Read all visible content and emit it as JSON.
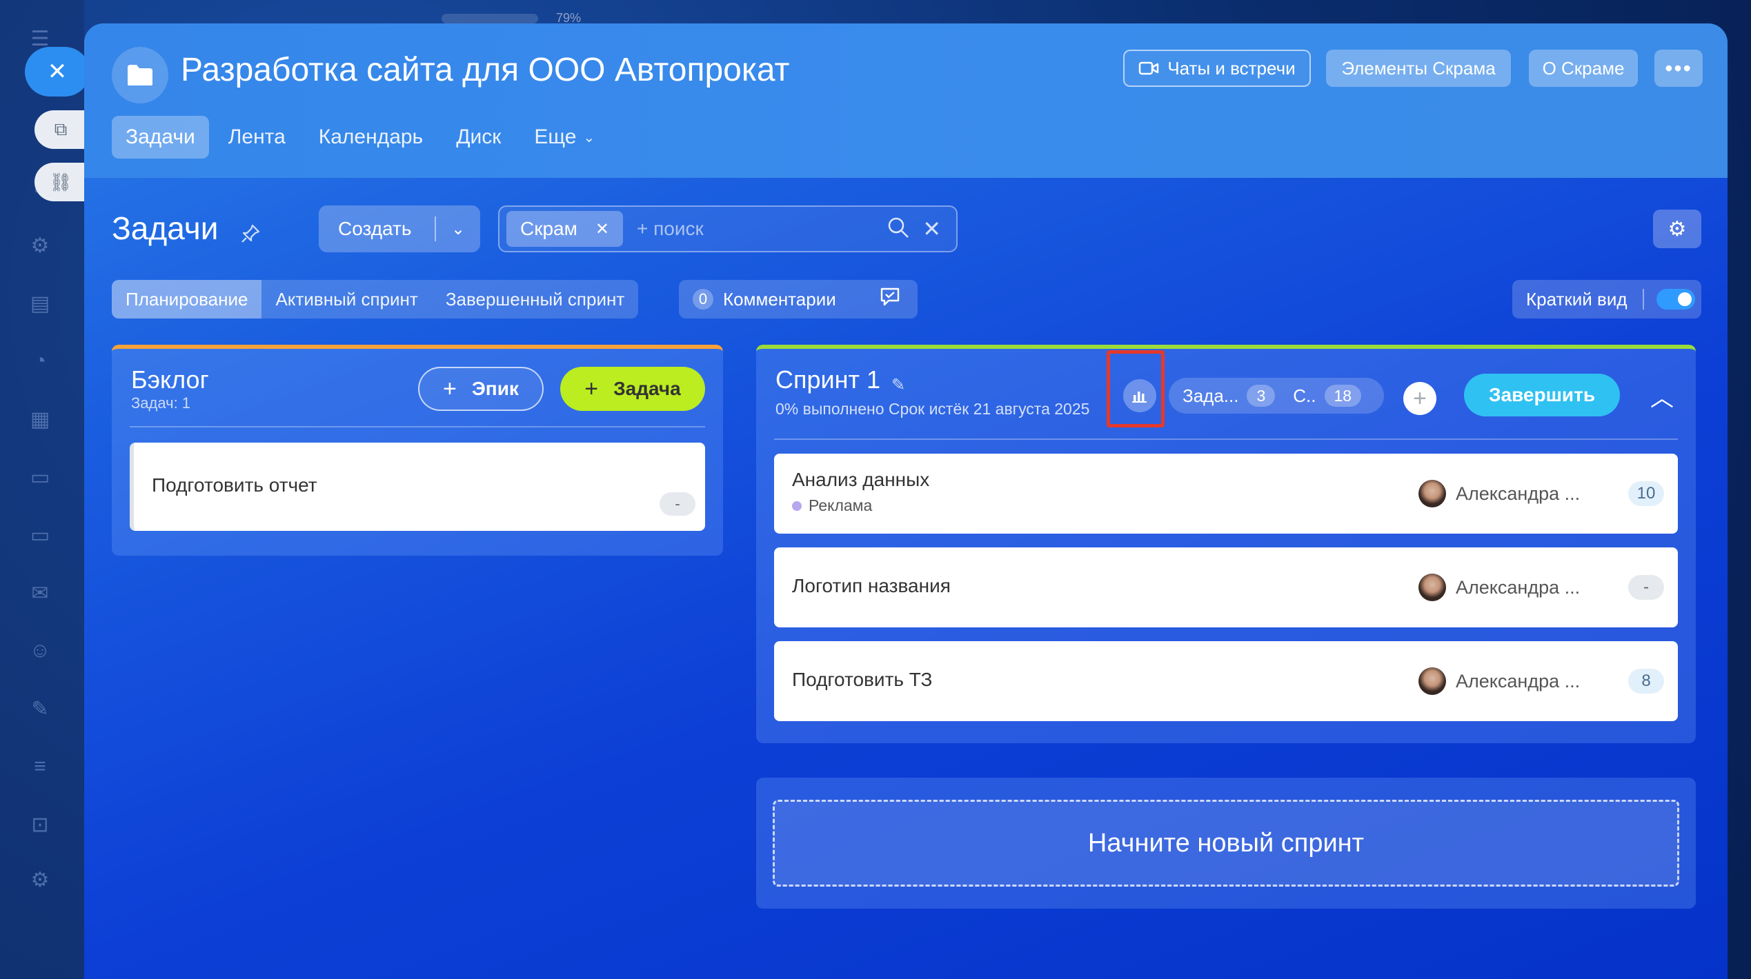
{
  "zoom_text": "79%",
  "project": {
    "title": "Разработка сайта для ООО Автопрокат",
    "buttons": {
      "chats": "Чаты и встречи",
      "elements": "Элементы Скрама",
      "about": "О Скраме",
      "more": "•••"
    }
  },
  "tabs": [
    {
      "label": "Задачи",
      "active": true
    },
    {
      "label": "Лента"
    },
    {
      "label": "Календарь"
    },
    {
      "label": "Диск"
    },
    {
      "label": "Еще"
    }
  ],
  "toolbar": {
    "page_title": "Задачи",
    "create_label": "Создать",
    "filter_chip": "Скрам",
    "search_placeholder": "+ поиск"
  },
  "view_tabs": [
    {
      "label": "Планирование",
      "active": true
    },
    {
      "label": "Активный спринт"
    },
    {
      "label": "Завершенный спринт"
    }
  ],
  "comments": {
    "count": "0",
    "label": "Комментарии"
  },
  "compact_view": {
    "label": "Краткий вид",
    "on": true
  },
  "backlog": {
    "title": "Бэклог",
    "subtitle": "Задач: 1",
    "epic_button": "Эпик",
    "task_button": "Задача",
    "items": [
      {
        "title": "Подготовить отчет",
        "points": "-"
      }
    ],
    "accent_color": "#f7a23a"
  },
  "sprint": {
    "title": "Спринт 1",
    "subtitle": "0% выполнено Срок истёк 21 августа 2025",
    "stats": {
      "tasks_label": "Зада...",
      "tasks_count": "3",
      "sp_label": "С..",
      "sp_count": "18"
    },
    "finish_button": "Завершить",
    "accent_color": "#9bdc3a",
    "items": [
      {
        "title": "Анализ данных",
        "epic": "Реклама",
        "assignee": "Александра ...",
        "points": "10"
      },
      {
        "title": "Логотип названия",
        "assignee": "Александра ...",
        "points": "-"
      },
      {
        "title": "Подготовить ТЗ",
        "assignee": "Александра ...",
        "points": "8"
      }
    ]
  },
  "new_sprint_label": "Начните новый спринт",
  "highlight_color": "#e5392b",
  "icons": {
    "close": "close-icon",
    "folder": "folder-icon",
    "video": "video-icon",
    "pin": "pin-icon",
    "search": "search-icon",
    "settings": "gear-icon",
    "chart": "bar-chart-icon",
    "chat": "chat-check-icon"
  }
}
